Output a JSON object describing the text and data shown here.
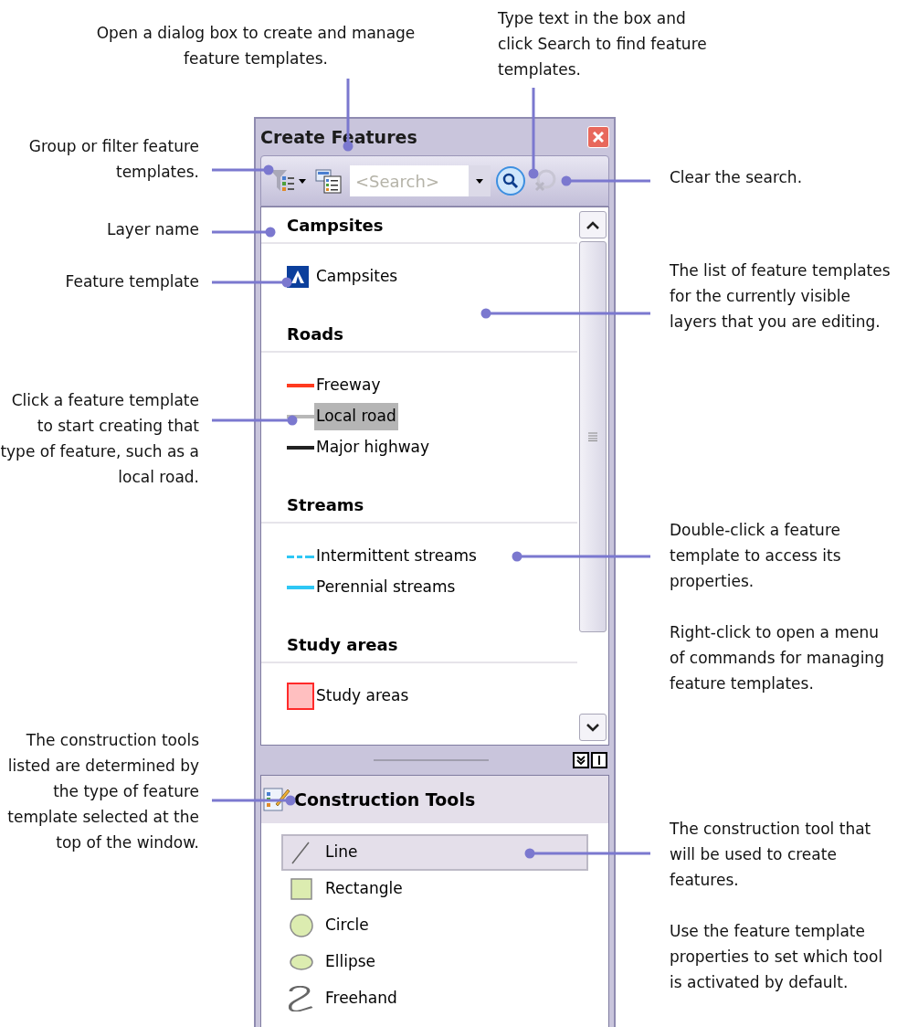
{
  "window": {
    "title": "Create Features"
  },
  "toolbar": {
    "search": {
      "placeholder": "<Search>"
    }
  },
  "templates": [
    {
      "layer": "Campsites",
      "items": [
        {
          "label": "Campsites",
          "kind": "marker",
          "color": "#0b3f9c",
          "selected": false
        }
      ]
    },
    {
      "layer": "Roads",
      "items": [
        {
          "label": "Freeway",
          "kind": "line",
          "color": "#ff3b1f",
          "selected": false
        },
        {
          "label": "Local road",
          "kind": "line",
          "color": "#b8b8b8",
          "selected": true
        },
        {
          "label": "Major highway",
          "kind": "line",
          "color": "#222222",
          "selected": false
        }
      ]
    },
    {
      "layer": "Streams",
      "items": [
        {
          "label": "Intermittent streams",
          "kind": "dashed",
          "color": "#2ec7f5",
          "selected": false
        },
        {
          "label": "Perennial streams",
          "kind": "line",
          "color": "#2ec7f5",
          "selected": false
        }
      ]
    },
    {
      "layer": "Study areas",
      "items": [
        {
          "label": "Study areas",
          "kind": "polygon",
          "color": "#ff2a2a",
          "selected": false
        }
      ]
    }
  ],
  "construction_tools": {
    "title": "Construction Tools",
    "tools": [
      {
        "label": "Line",
        "kind": "line",
        "selected": true
      },
      {
        "label": "Rectangle",
        "kind": "rectangle",
        "selected": false
      },
      {
        "label": "Circle",
        "kind": "circle",
        "selected": false
      },
      {
        "label": "Ellipse",
        "kind": "ellipse",
        "selected": false
      },
      {
        "label": "Freehand",
        "kind": "freehand",
        "selected": false
      }
    ]
  },
  "callouts": [
    {
      "text": "Open a dialog box to create and manage feature templates."
    },
    {
      "text": "Type text in the box and click Search to find feature templates."
    },
    {
      "text": "Group or filter feature templates."
    },
    {
      "text": "Layer name"
    },
    {
      "text": "Feature template"
    },
    {
      "text": "Click a feature template to start creating that type of feature, such as a local road."
    },
    {
      "text": "The construction tools listed are determined by the type of feature template selected at the top of the window."
    },
    {
      "text": "Clear the search."
    },
    {
      "text": "The list of feature templates for the currently visible layers that you are editing."
    },
    {
      "text": "Double-click a feature template to access its properties."
    },
    {
      "text": "Right-click to open a menu of commands for managing feature templates."
    },
    {
      "text": "The construction tool that will be used to create features."
    },
    {
      "text": "Use the feature template properties to set which tool is activated by default."
    }
  ]
}
